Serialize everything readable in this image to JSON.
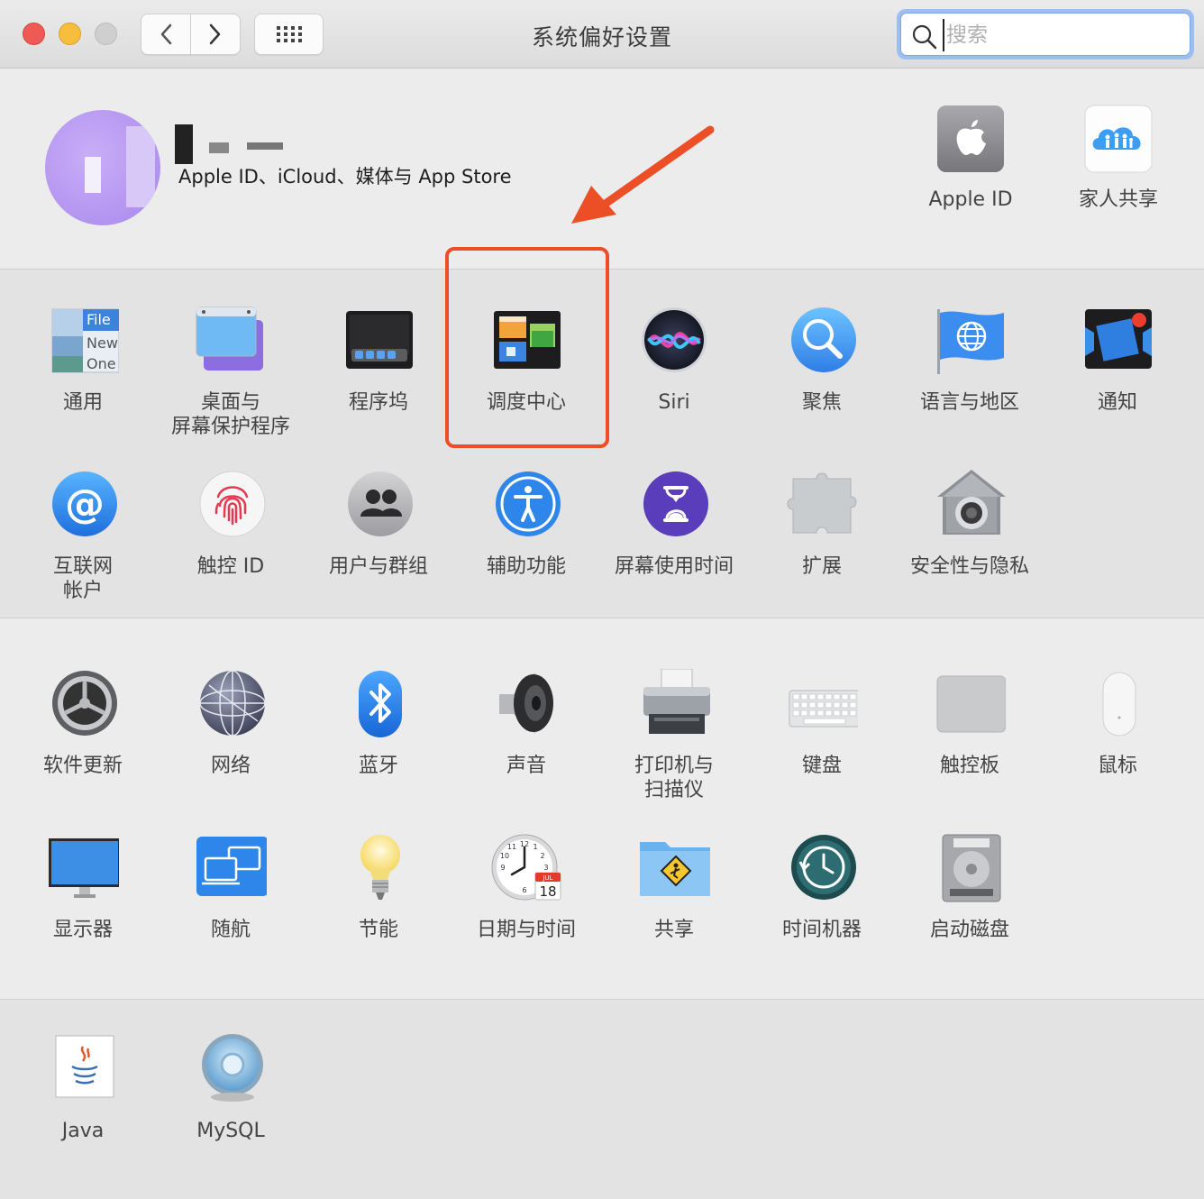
{
  "window": {
    "title": "系统偏好设置"
  },
  "search": {
    "placeholder": "搜索"
  },
  "account": {
    "subtitle": "Apple ID、iCloud、媒体与 App Store"
  },
  "top_items": [
    {
      "label": "Apple ID",
      "icon": "apple-logo-icon"
    },
    {
      "label": "家人共享",
      "icon": "family-sharing-icon"
    }
  ],
  "section1": [
    {
      "label": "通用",
      "icon": "general-icon"
    },
    {
      "label": "桌面与\n屏幕保护程序",
      "icon": "desktop-screensaver-icon"
    },
    {
      "label": "程序坞",
      "icon": "dock-icon"
    },
    {
      "label": "调度中心",
      "icon": "mission-control-icon"
    },
    {
      "label": "Siri",
      "icon": "siri-icon"
    },
    {
      "label": "聚焦",
      "icon": "spotlight-icon"
    },
    {
      "label": "语言与地区",
      "icon": "language-region-icon"
    },
    {
      "label": "通知",
      "icon": "notifications-icon"
    },
    {
      "label": "互联网\n帐户",
      "icon": "internet-accounts-icon"
    },
    {
      "label": "触控 ID",
      "icon": "touch-id-icon"
    },
    {
      "label": "用户与群组",
      "icon": "users-groups-icon"
    },
    {
      "label": "辅助功能",
      "icon": "accessibility-icon"
    },
    {
      "label": "屏幕使用时间",
      "icon": "screen-time-icon"
    },
    {
      "label": "扩展",
      "icon": "extensions-icon"
    },
    {
      "label": "安全性与隐私",
      "icon": "security-privacy-icon"
    }
  ],
  "section2": [
    {
      "label": "软件更新",
      "icon": "software-update-icon"
    },
    {
      "label": "网络",
      "icon": "network-icon"
    },
    {
      "label": "蓝牙",
      "icon": "bluetooth-icon"
    },
    {
      "label": "声音",
      "icon": "sound-icon"
    },
    {
      "label": "打印机与\n扫描仪",
      "icon": "printer-scanner-icon"
    },
    {
      "label": "键盘",
      "icon": "keyboard-icon"
    },
    {
      "label": "触控板",
      "icon": "trackpad-icon"
    },
    {
      "label": "鼠标",
      "icon": "mouse-icon"
    },
    {
      "label": "显示器",
      "icon": "displays-icon"
    },
    {
      "label": "随航",
      "icon": "sidecar-icon"
    },
    {
      "label": "节能",
      "icon": "energy-saver-icon"
    },
    {
      "label": "日期与时间",
      "icon": "date-time-icon"
    },
    {
      "label": "共享",
      "icon": "sharing-icon"
    },
    {
      "label": "时间机器",
      "icon": "time-machine-icon"
    },
    {
      "label": "启动磁盘",
      "icon": "startup-disk-icon"
    }
  ],
  "section3": [
    {
      "label": "Java",
      "icon": "java-icon"
    },
    {
      "label": "MySQL",
      "icon": "mysql-icon"
    }
  ],
  "icon_text": {
    "general_file": "File",
    "general_new": "New",
    "general_one": "One",
    "calendar_month": "JUL",
    "calendar_day": "18"
  },
  "colors": {
    "highlight": "#ec4e26",
    "accent": "#3a86f7"
  }
}
